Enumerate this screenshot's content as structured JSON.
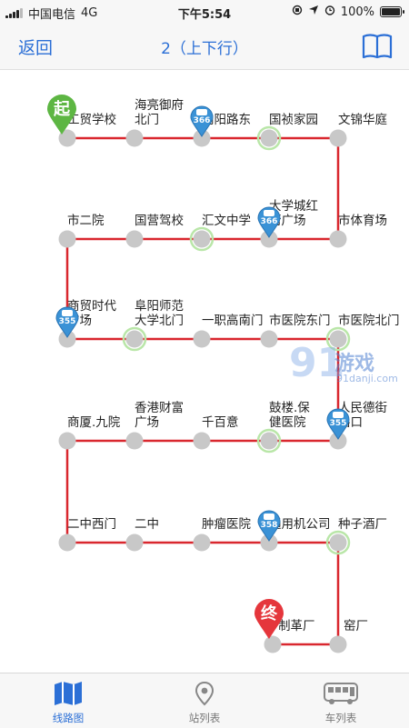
{
  "status_bar": {
    "carrier": "中国电信",
    "network": "4G",
    "time": "下午5:54",
    "battery": "100%"
  },
  "nav": {
    "back_label": "返回",
    "title": "2（上下行）"
  },
  "route_color": "#d9272e",
  "accent_color": "#2b6fd6",
  "stops": [
    {
      "name": "工贸学校",
      "row": 0,
      "col": 0,
      "highlight": false
    },
    {
      "name": "海亮御府北门",
      "row": 0,
      "col": 1,
      "highlight": false
    },
    {
      "name": "向阳路东",
      "row": 0,
      "col": 2,
      "highlight": false
    },
    {
      "name": "国祯家园",
      "row": 0,
      "col": 3,
      "highlight": true
    },
    {
      "name": "文锦华庭",
      "row": 0,
      "col": 4,
      "highlight": false
    },
    {
      "name": "市体育场",
      "row": 1,
      "col": 4,
      "highlight": false
    },
    {
      "name": "大学城红街广场",
      "row": 1,
      "col": 3,
      "highlight": false
    },
    {
      "name": "汇文中学",
      "row": 1,
      "col": 2,
      "highlight": true
    },
    {
      "name": "国营驾校",
      "row": 1,
      "col": 1,
      "highlight": false
    },
    {
      "name": "市二院",
      "row": 1,
      "col": 0,
      "highlight": false
    },
    {
      "name": "商贸时代广场",
      "row": 2,
      "col": 0,
      "highlight": false
    },
    {
      "name": "阜阳师范大学北门",
      "row": 2,
      "col": 1,
      "highlight": true
    },
    {
      "name": "一职高南门",
      "row": 2,
      "col": 2,
      "highlight": false
    },
    {
      "name": "市医院东门",
      "row": 2,
      "col": 3,
      "highlight": false
    },
    {
      "name": "市医院北门",
      "row": 2,
      "col": 4,
      "highlight": true
    },
    {
      "name": "人民德街路口",
      "row": 3,
      "col": 4,
      "highlight": false
    },
    {
      "name": "鼓楼.保健医院",
      "row": 3,
      "col": 3,
      "highlight": true
    },
    {
      "name": "千百意",
      "row": 3,
      "col": 2,
      "highlight": false
    },
    {
      "name": "香港财富广场",
      "row": 3,
      "col": 1,
      "highlight": false
    },
    {
      "name": "商厦.九院",
      "row": 3,
      "col": 0,
      "highlight": false
    },
    {
      "name": "二中西门",
      "row": 4,
      "col": 0,
      "highlight": false
    },
    {
      "name": "二中",
      "row": 4,
      "col": 1,
      "highlight": false
    },
    {
      "name": "肿瘤医院",
      "row": 4,
      "col": 2,
      "highlight": false
    },
    {
      "name": "通用机公司",
      "row": 4,
      "col": 3,
      "highlight": false
    },
    {
      "name": "种子酒厂",
      "row": 4,
      "col": 4,
      "highlight": true
    },
    {
      "name": "窑厂",
      "row": 5,
      "col": 4,
      "highlight": false
    },
    {
      "name": "制革厂",
      "row": 5,
      "col": 3,
      "highlight": false
    }
  ],
  "start_marker": {
    "label": "起"
  },
  "end_marker": {
    "label": "终"
  },
  "buses": [
    {
      "number": "366",
      "row": 0,
      "col": 2
    },
    {
      "number": "366",
      "row": 1,
      "col": 3
    },
    {
      "number": "355",
      "row": 2,
      "col": 0
    },
    {
      "number": "355",
      "row": 3,
      "col": 4
    },
    {
      "number": "358",
      "row": 4,
      "col": 3
    }
  ],
  "watermark": {
    "number": "91",
    "name": "游戏",
    "url": "91danji.com"
  },
  "tabs": [
    {
      "label": "线路图",
      "icon": "map-icon",
      "active": true
    },
    {
      "label": "站列表",
      "icon": "location-pin-icon",
      "active": false
    },
    {
      "label": "车列表",
      "icon": "bus-icon",
      "active": false
    }
  ]
}
